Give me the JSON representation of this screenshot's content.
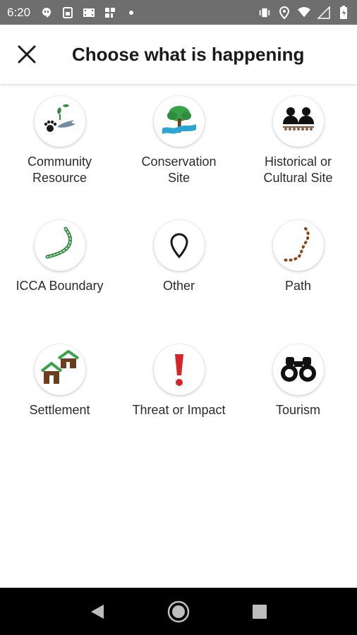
{
  "status_bar": {
    "time": "6:20",
    "left_icons": [
      "hangouts-icon",
      "sim-card-icon",
      "film-icon",
      "app-icon",
      "dot-icon"
    ],
    "right_icons": [
      "vibrate-icon",
      "location-icon",
      "wifi-icon",
      "signal-icon",
      "battery-icon"
    ]
  },
  "app_bar": {
    "title": "Choose what is happening",
    "close_icon": "close-icon"
  },
  "categories": [
    {
      "label": "Community\nResource",
      "icon": "community-resource-icon"
    },
    {
      "label": "Conservation\nSite",
      "icon": "conservation-site-icon"
    },
    {
      "label": "Historical or\nCultural Site",
      "icon": "historical-cultural-icon"
    },
    {
      "label": "ICCA Boundary",
      "icon": "icca-boundary-icon"
    },
    {
      "label": "Other",
      "icon": "map-pin-icon"
    },
    {
      "label": "Path",
      "icon": "path-icon"
    },
    {
      "label": "Settlement",
      "icon": "settlement-icon"
    },
    {
      "label": "Threat or Impact",
      "icon": "exclamation-icon"
    },
    {
      "label": "Tourism",
      "icon": "binoculars-icon"
    }
  ],
  "nav_bar": {
    "icons": [
      "back-icon",
      "home-icon",
      "recents-icon"
    ]
  },
  "colors": {
    "status_bar_bg": "#6e6e6e",
    "nav_bar_bg": "#000000",
    "tree_green": "#3aa34a",
    "trunk_brown": "#6b3f1e",
    "threat_red": "#d6242a",
    "water_blue": "#2aa6d6"
  }
}
